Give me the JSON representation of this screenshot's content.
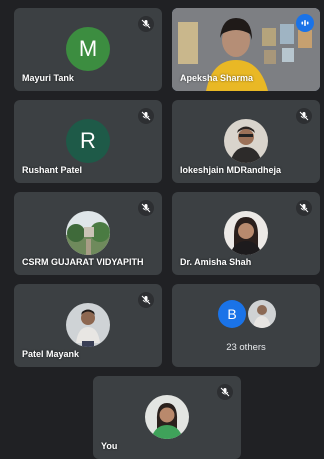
{
  "participants": [
    {
      "name": "Mayuri Tank",
      "initial": "M",
      "avatar_color": "#3c8d40",
      "muted": true
    },
    {
      "name": "Apeksha Sharma",
      "muted": false,
      "speaking": true
    },
    {
      "name": "Rushant Patel",
      "initial": "R",
      "avatar_color": "#1e5a48",
      "muted": true
    },
    {
      "name": "lokeshjain MDRandheja",
      "muted": true
    },
    {
      "name": "CSRM GUJARAT VIDYAPITH",
      "muted": true
    },
    {
      "name": "Dr. Amisha Shah",
      "muted": true
    },
    {
      "name": "Patel Mayank",
      "muted": true
    }
  ],
  "others": {
    "initial": "B",
    "avatar_color": "#1a73e8",
    "label": "23 others"
  },
  "self": {
    "name": "You",
    "muted": true
  },
  "colors": {
    "background": "#202124",
    "tile": "#3c4043",
    "active_border": "#8ab4f8",
    "speaking_badge": "#1a73e8"
  }
}
